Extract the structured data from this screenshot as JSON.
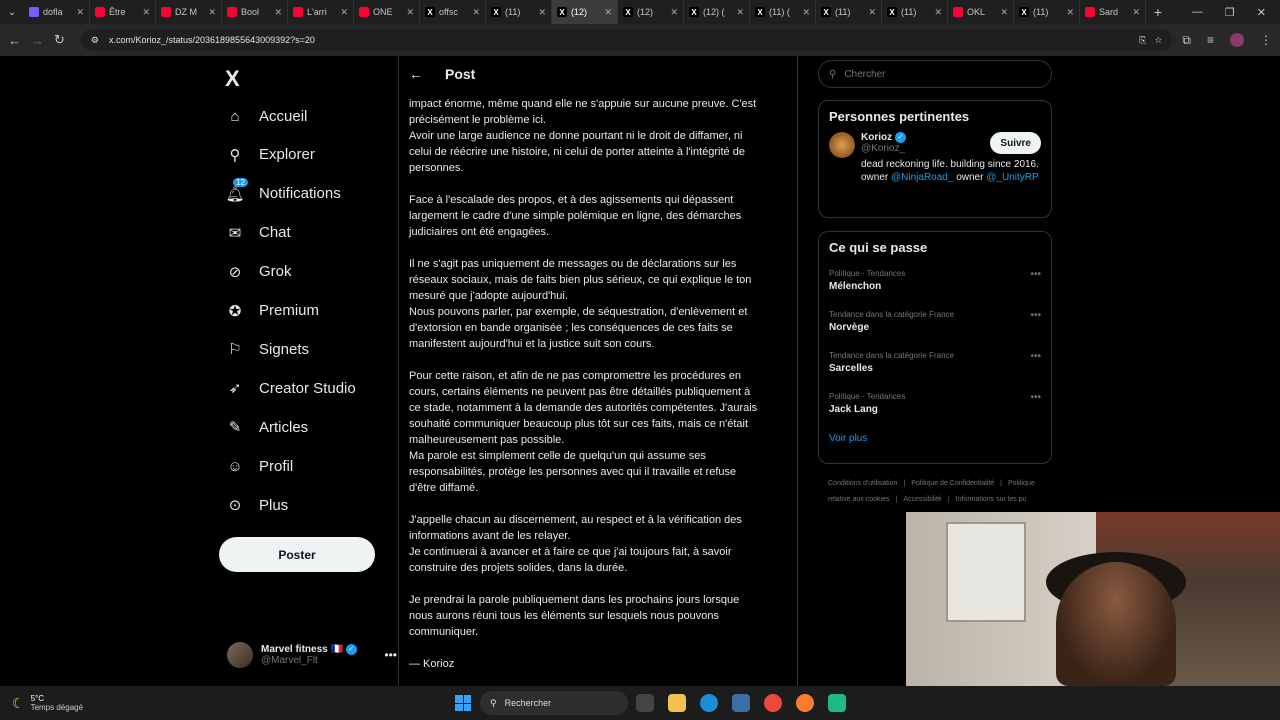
{
  "browser": {
    "tabs": [
      {
        "label": "dofla",
        "color": "#7b5cff"
      },
      {
        "label": "Être",
        "color": "#ff0033"
      },
      {
        "label": "DZ M",
        "color": "#ff0033"
      },
      {
        "label": "Bool",
        "color": "#ff0033"
      },
      {
        "label": "L'arri",
        "color": "#ff0033"
      },
      {
        "label": "ONE",
        "color": "#ff0033"
      },
      {
        "label": "offsc",
        "color": "#000000"
      },
      {
        "label": "(11)",
        "color": "#000000"
      },
      {
        "label": "(12)",
        "color": "#000000",
        "active": true
      },
      {
        "label": "(12)",
        "color": "#000000"
      },
      {
        "label": "(12) (",
        "color": "#000000"
      },
      {
        "label": "(11) (",
        "color": "#000000"
      },
      {
        "label": "(11)",
        "color": "#000000"
      },
      {
        "label": "(11)",
        "color": "#000000"
      },
      {
        "label": "OKL",
        "color": "#ff0033"
      },
      {
        "label": "(11)",
        "color": "#000000"
      },
      {
        "label": "Sard",
        "color": "#ff0033"
      }
    ],
    "url": "x.com/Korioz_/status/2036189855643009392?s=20"
  },
  "sidebar": {
    "logo": "X",
    "items": [
      {
        "label": "Accueil",
        "icon": "home-icon",
        "glyph": "⌂"
      },
      {
        "label": "Explorer",
        "icon": "search-icon",
        "glyph": "⚲"
      },
      {
        "label": "Notifications",
        "icon": "bell-icon",
        "glyph": "🔔︎"
      },
      {
        "label": "Chat",
        "icon": "mail-icon",
        "glyph": "✉"
      },
      {
        "label": "Grok",
        "icon": "grok-icon",
        "glyph": "⊘"
      },
      {
        "label": "Premium",
        "icon": "premium-icon",
        "glyph": "✪"
      },
      {
        "label": "Signets",
        "icon": "bookmark-icon",
        "glyph": "⚐"
      },
      {
        "label": "Creator Studio",
        "icon": "rocket-icon",
        "glyph": "➶"
      },
      {
        "label": "Articles",
        "icon": "article-icon",
        "glyph": "✎"
      },
      {
        "label": "Profil",
        "icon": "profile-icon",
        "glyph": "☺"
      },
      {
        "label": "Plus",
        "icon": "more-icon",
        "glyph": "⊙"
      }
    ],
    "notif_badge": "12",
    "post_button": "Poster",
    "account": {
      "name": "Marvel fitness 🇫🇷",
      "handle": "@Marvel_Flt"
    }
  },
  "main": {
    "header_title": "Post",
    "lines": [
      "impact énorme, même quand elle ne s'appuie sur aucune preuve. C'est",
      "précisément le problème ici.",
      "Avoir une large audience ne donne pourtant ni le droit de diffamer, ni",
      "celui de réécrire une histoire, ni celui de porter atteinte à l'intégrité de",
      "personnes.",
      "",
      "Face à l'escalade des propos, et à des agissements qui dépassent",
      "largement le cadre d'une simple polémique en ligne, des démarches",
      "judiciaires ont été engagées.",
      "",
      "Il ne s'agit pas uniquement de messages ou de déclarations sur les",
      "réseaux sociaux, mais de faits bien plus sérieux, ce qui explique le ton",
      "mesuré que j'adopte aujourd'hui.",
      "Nous pouvons parler, par exemple, de séquestration, d'enlèvement et",
      "d'extorsion en bande organisée ; les conséquences de ces faits se",
      "manifestent aujourd'hui et la justice suit son cours.",
      "",
      "Pour cette raison, et afin de ne pas compromettre les procédures en",
      "cours, certains éléments ne peuvent pas être détaillés publiquement à",
      "ce stade, notamment à la demande des autorités compétentes. J'aurais",
      "souhaité communiquer beaucoup plus tôt sur ces faits, mais ce n'était",
      "malheureusement pas possible.",
      "Ma parole est simplement celle de quelqu'un qui assume ses",
      "responsabilités, protège les personnes avec qui il travaille et refuse",
      "d'être diffamé.",
      "",
      "J'appelle chacun au discernement, au respect et à la vérification des",
      "informations avant de les relayer.",
      "Je continuerai à avancer et à faire ce que j'ai toujours fait, à savoir",
      "construire des projets solides, dans la durée.",
      "",
      "Je prendrai la parole publiquement dans les prochains jours lorsque",
      "nous aurons réuni tous les éléments sur lesquels nous pouvons",
      "communiquer.",
      "",
      "— Korioz"
    ]
  },
  "right": {
    "search_placeholder": "Chercher",
    "relevant": {
      "title": "Personnes pertinentes",
      "name": "Korioz",
      "handle": "@Korioz_",
      "follow": "Suivre",
      "bio_text": "dead reckoning life. building since 2016. owner ",
      "bio_link1": "@NinjaRoad_",
      "bio_mid": " owner ",
      "bio_link2": "@_UnityRP"
    },
    "happening": {
      "title": "Ce qui se passe",
      "trends": [
        {
          "meta": "Politique · Tendances",
          "name": "Mélenchon"
        },
        {
          "meta": "Tendance dans la catégorie France",
          "name": "Norvège"
        },
        {
          "meta": "Tendance dans la catégorie France",
          "name": "Sarcelles"
        },
        {
          "meta": "Politique · Tendances",
          "name": "Jack Lang"
        }
      ],
      "see_more": "Voir plus"
    },
    "footer": [
      "Conditions d'utilisation",
      "Politique de Confidentialité",
      "Politique relative aux cookies",
      "Accessibilité",
      "Informations sur les pu"
    ]
  },
  "taskbar": {
    "temp": "5°C",
    "weather": "Temps dégagé",
    "search": "Rechercher"
  }
}
